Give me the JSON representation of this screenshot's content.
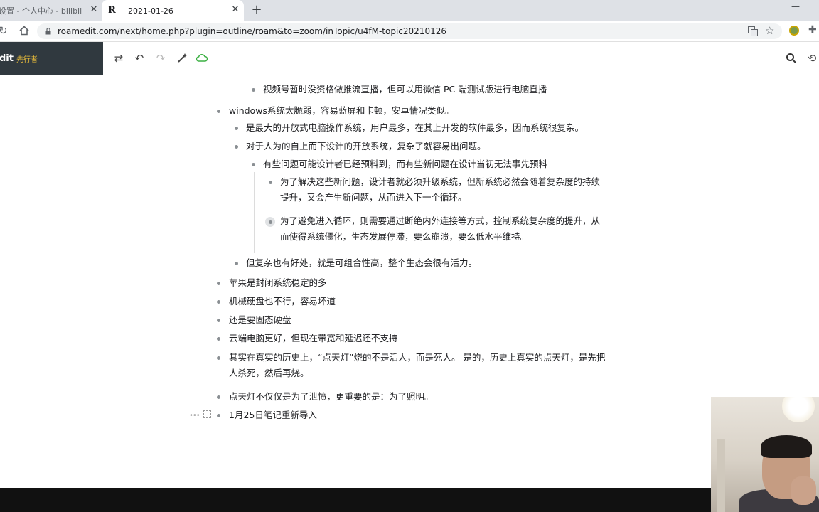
{
  "browser": {
    "tabs": [
      {
        "title": "设置 - 个人中心 - bilibili link",
        "close": "✕"
      },
      {
        "title": "2021-01-26",
        "favicon": "R",
        "close": "✕"
      }
    ],
    "new_tab": "+",
    "minimize": "—",
    "url": "roamedit.com/next/home.php?plugin=outline/roam&to=zoom/inTopic/u4fM-topic20210126"
  },
  "app": {
    "brand_name": "dit",
    "brand_tag": "先行者",
    "brand_tag_color": "#f0c23a",
    "sidebar_color": "#30393f",
    "toolbar_icons": [
      "swap-icon",
      "undo-icon",
      "redo-icon",
      "wand-icon",
      "cloud-icon",
      "search-icon",
      "history-icon"
    ],
    "cloud_color": "#3cb043"
  },
  "outline": {
    "items": [
      {
        "text": "视频号暂时没资格做推流直播，但可以用微信 PC 端测试版进行电脑直播"
      },
      {
        "text": "windows系统太脆弱，容易蓝屏和卡顿，安卓情况类似。"
      },
      {
        "text": "是最大的开放式电脑操作系统，用户最多，在其上开发的软件最多，因而系统很复杂。"
      },
      {
        "text": "对于人为的自上而下设计的开放系统，复杂了就容易出问题。"
      },
      {
        "text": "有些问题可能设计者已经预料到，而有些新问题在设计当初无法事先预料"
      },
      {
        "line1": "为了解决这些新问题，设计者就必须升级系统，但新系统必然会随着复杂度的持续",
        "line2": "提升，又会产生新问题，从而进入下一个循环。"
      },
      {
        "line1": "为了避免进入循环，则需要通过断绝内外连接等方式，控制系统复杂度的提升，从",
        "line2": "而使得系统僵化，生态发展停滞，要么崩溃，要么低水平维持。"
      },
      {
        "text": "但复杂也有好处，就是可组合性高，整个生态会很有活力。"
      },
      {
        "text": "苹果是封闭系统稳定的多"
      },
      {
        "text": "机械硬盘也不行，容易坏道"
      },
      {
        "text": "还是要固态硬盘"
      },
      {
        "text": "云端电脑更好，但现在带宽和延迟还不支持"
      },
      {
        "line1": "其实在真实的历史上，“点天灯”烧的不是活人，而是死人。 是的，历史上真实的点天灯，是先把",
        "line2": "人杀死，然后再烧。"
      },
      {
        "text": "点天灯不仅仅是为了泄愤，更重要的是：为了照明。"
      },
      {
        "text": "1月25日笔记重新导入"
      }
    ],
    "controls": {
      "dots": "•••"
    }
  }
}
